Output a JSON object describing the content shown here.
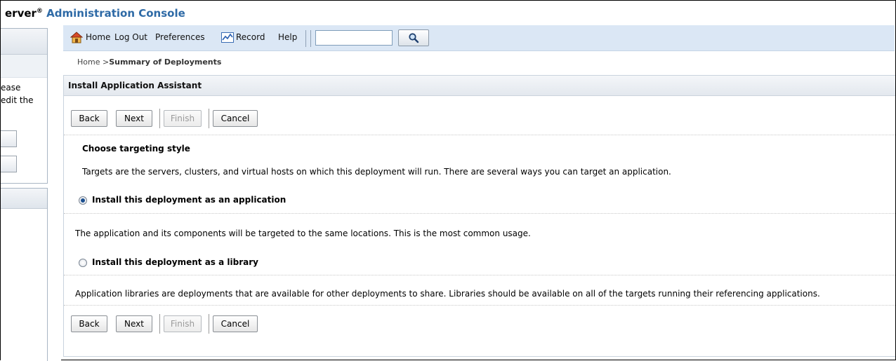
{
  "brand": {
    "prefix": "erver",
    "registered": "®",
    "title": "Administration Console"
  },
  "left_panel": {
    "text_line1": "ease",
    "text_line2": "edit the"
  },
  "toolbar": {
    "home_label": "Home",
    "logout_label": "Log Out",
    "preferences_label": "Preferences",
    "record_label": "Record",
    "help_label": "Help",
    "search_value": ""
  },
  "breadcrumb": {
    "home": "Home >",
    "current": "Summary of Deployments"
  },
  "assistant": {
    "title": "Install Application Assistant",
    "buttons": {
      "back": "Back",
      "next": "Next",
      "finish": "Finish",
      "cancel": "Cancel"
    },
    "heading": "Choose targeting style",
    "intro": "Targets are the servers, clusters, and virtual hosts on which this deployment will run. There are several ways you can target an application.",
    "options": [
      {
        "label": "Install this deployment as an application",
        "selected": true,
        "description": "The application and its components will be targeted to the same locations. This is the most common usage."
      },
      {
        "label": "Install this deployment as a library",
        "selected": false,
        "description": "Application libraries are deployments that are available for other deployments to share. Libraries should be available on all of the targets running their referencing applications."
      }
    ]
  },
  "colors": {
    "toolbar_bg": "#dbe7f5",
    "brand_title": "#2e6aa6",
    "radio_dot": "#1b4f8f"
  }
}
